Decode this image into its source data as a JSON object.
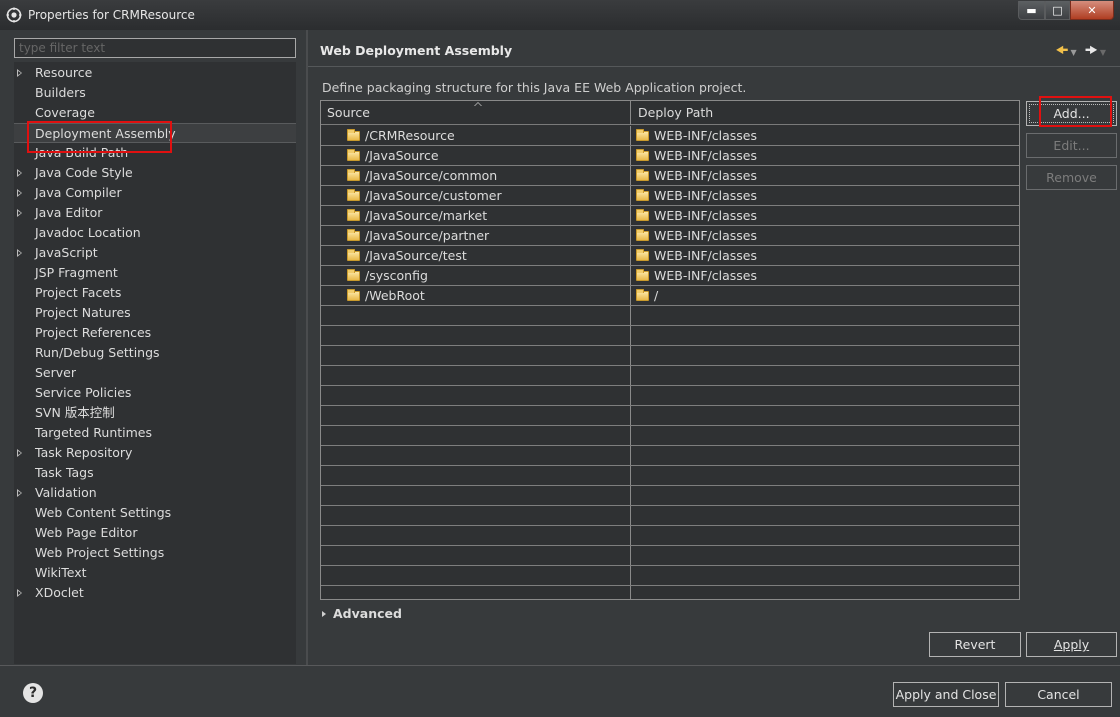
{
  "window": {
    "title": "Properties for CRMResource",
    "controls": {
      "minimize": "minimize-icon",
      "maximize": "maximize-icon",
      "close": "close-icon"
    }
  },
  "filter": {
    "placeholder": "type filter text"
  },
  "tree": {
    "items": [
      {
        "label": "Resource",
        "expandable": true
      },
      {
        "label": "Builders",
        "expandable": false
      },
      {
        "label": "Coverage",
        "expandable": false
      },
      {
        "label": "Deployment Assembly",
        "expandable": false,
        "selected": true
      },
      {
        "label": "Java Build Path",
        "expandable": false
      },
      {
        "label": "Java Code Style",
        "expandable": true
      },
      {
        "label": "Java Compiler",
        "expandable": true
      },
      {
        "label": "Java Editor",
        "expandable": true
      },
      {
        "label": "Javadoc Location",
        "expandable": false
      },
      {
        "label": "JavaScript",
        "expandable": true
      },
      {
        "label": "JSP Fragment",
        "expandable": false
      },
      {
        "label": "Project Facets",
        "expandable": false
      },
      {
        "label": "Project Natures",
        "expandable": false
      },
      {
        "label": "Project References",
        "expandable": false
      },
      {
        "label": "Run/Debug Settings",
        "expandable": false
      },
      {
        "label": "Server",
        "expandable": false
      },
      {
        "label": "Service Policies",
        "expandable": false
      },
      {
        "label": "SVN 版本控制",
        "expandable": false
      },
      {
        "label": "Targeted Runtimes",
        "expandable": false
      },
      {
        "label": "Task Repository",
        "expandable": true
      },
      {
        "label": "Task Tags",
        "expandable": false
      },
      {
        "label": "Validation",
        "expandable": true
      },
      {
        "label": "Web Content Settings",
        "expandable": false
      },
      {
        "label": "Web Page Editor",
        "expandable": false
      },
      {
        "label": "Web Project Settings",
        "expandable": false
      },
      {
        "label": "WikiText",
        "expandable": false
      },
      {
        "label": "XDoclet",
        "expandable": true
      }
    ]
  },
  "page": {
    "title": "Web Deployment Assembly",
    "description": "Define packaging structure for this Java EE Web Application project.",
    "nav": {
      "back_icon": "back-arrow-icon",
      "forward_icon": "forward-arrow-icon"
    }
  },
  "table": {
    "columns": [
      "Source",
      "Deploy Path"
    ],
    "rows": [
      {
        "source": "/CRMResource",
        "deploy": "WEB-INF/classes"
      },
      {
        "source": "/JavaSource",
        "deploy": "WEB-INF/classes"
      },
      {
        "source": "/JavaSource/common",
        "deploy": "WEB-INF/classes"
      },
      {
        "source": "/JavaSource/customer",
        "deploy": "WEB-INF/classes"
      },
      {
        "source": "/JavaSource/market",
        "deploy": "WEB-INF/classes"
      },
      {
        "source": "/JavaSource/partner",
        "deploy": "WEB-INF/classes"
      },
      {
        "source": "/JavaSource/test",
        "deploy": "WEB-INF/classes"
      },
      {
        "source": "/sysconfig",
        "deploy": "WEB-INF/classes"
      },
      {
        "source": "/WebRoot",
        "deploy": "/"
      }
    ]
  },
  "buttons": {
    "add": "Add...",
    "edit": "Edit...",
    "remove": "Remove",
    "revert": "Revert",
    "apply": "Apply",
    "apply_close": "Apply and Close",
    "cancel": "Cancel"
  },
  "advanced": {
    "label": "Advanced"
  },
  "colors": {
    "highlight_box": "#e01010",
    "folder": "#e9b948",
    "background": "#373a3c"
  }
}
